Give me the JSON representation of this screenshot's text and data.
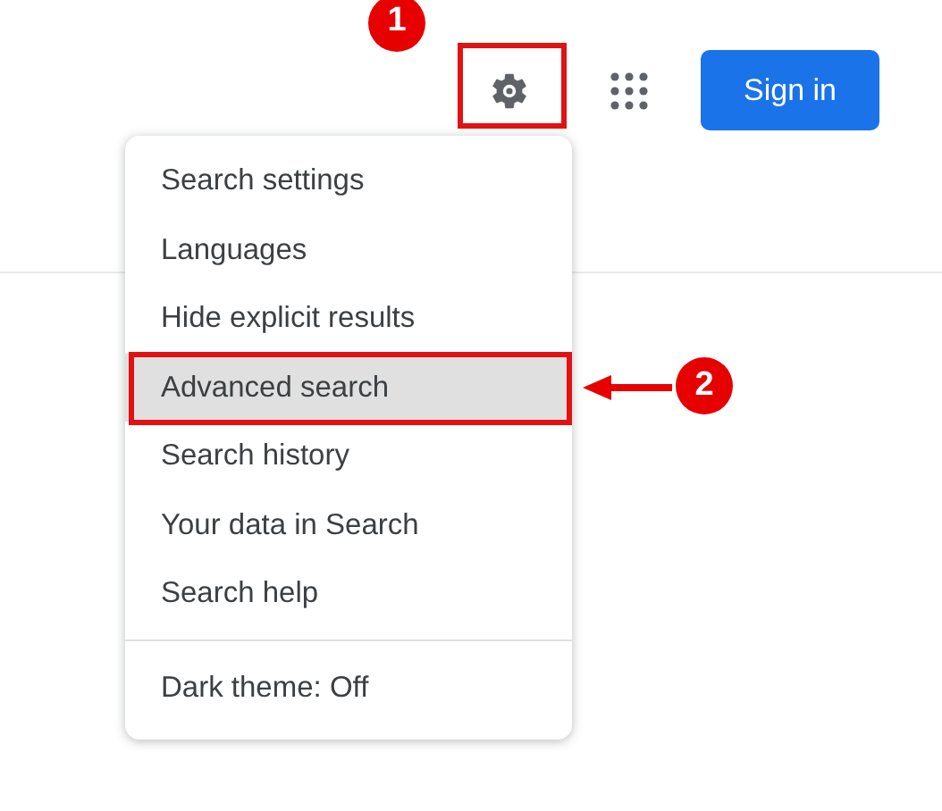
{
  "header": {
    "settings_button": {
      "highlighted": true
    },
    "sign_in": "Sign in"
  },
  "menu": {
    "items": [
      {
        "label": "Search settings",
        "selected": false
      },
      {
        "label": "Languages",
        "selected": false
      },
      {
        "label": "Hide explicit results",
        "selected": false
      },
      {
        "label": "Advanced search",
        "selected": true
      },
      {
        "label": "Search history",
        "selected": false
      },
      {
        "label": "Your data in Search",
        "selected": false
      },
      {
        "label": "Search help",
        "selected": false
      }
    ],
    "footer_items": [
      {
        "label": "Dark theme: Off",
        "selected": false
      }
    ]
  },
  "annotations": [
    {
      "label": "1"
    },
    {
      "label": "2"
    }
  ]
}
